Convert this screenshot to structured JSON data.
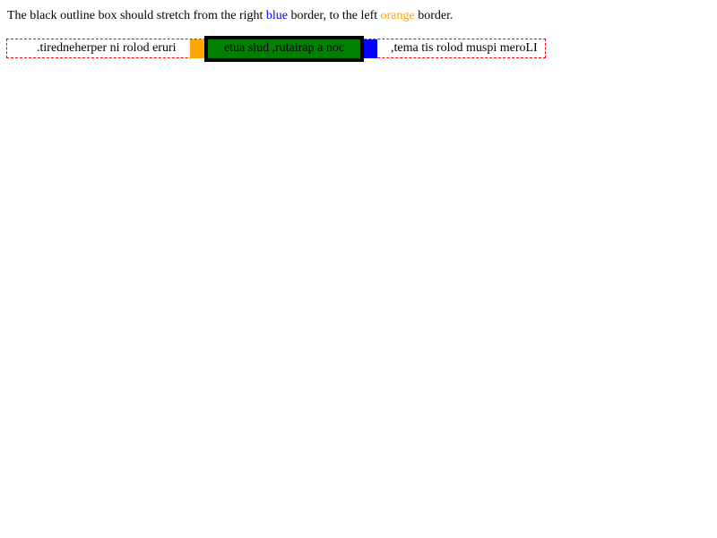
{
  "instruction": {
    "before": "The black outline box should stretch from the right ",
    "blue_word": "blue",
    "middle": " border, to the left ",
    "orange_word": "orange",
    "after": " border."
  },
  "test": {
    "left_text": ".tiredneherper ni rolod eruri",
    "center_text": "etua siud ,rutairap a noc",
    "right_text": ",tema tis rolod muspi meroLI"
  },
  "colors": {
    "blue": "#0000ff",
    "orange": "#ffa500",
    "green": "#008000",
    "dashed_border": "#ff0000",
    "outline": "#000000"
  }
}
